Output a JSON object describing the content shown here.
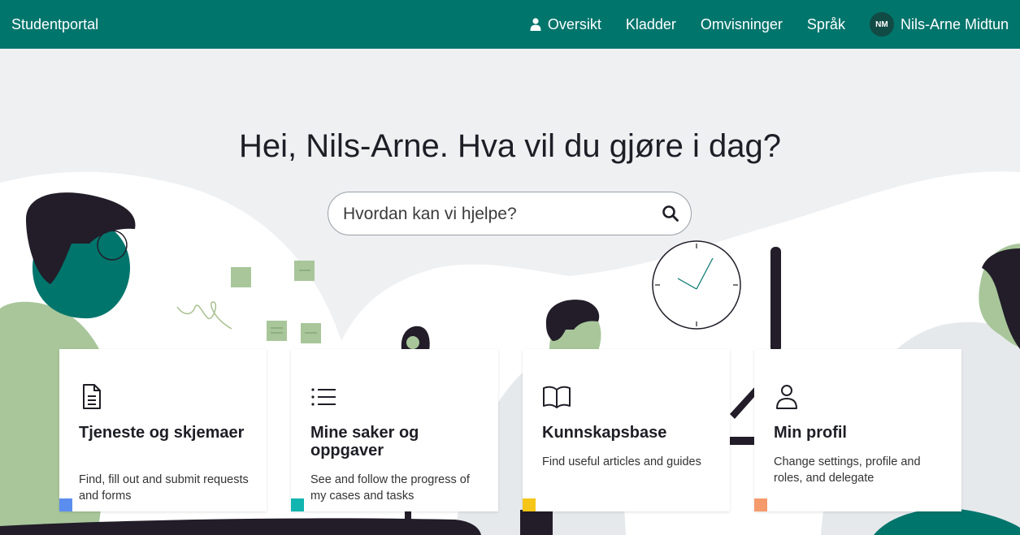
{
  "app": {
    "brand": "Studentportal"
  },
  "nav": {
    "items": [
      {
        "label": "Oversikt",
        "icon": "user-icon"
      },
      {
        "label": "Kladder"
      },
      {
        "label": "Omvisninger"
      },
      {
        "label": "Språk"
      }
    ],
    "user": {
      "initials": "NM",
      "name": "Nils-Arne Midtun"
    }
  },
  "hero": {
    "greeting": "Hei, Nils-Arne. Hva vil du gjøre i dag?"
  },
  "search": {
    "placeholder": "Hvordan kan vi hjelpe?",
    "value": "",
    "icon": "search-icon"
  },
  "cards": [
    {
      "title": "Tjeneste og skjemaer",
      "desc": "Find, fill out and submit requests and forms",
      "icon": "document-icon",
      "accent": "#5b8def"
    },
    {
      "title": "Mine saker og oppgaver",
      "desc": "See and follow the progress of my cases and tasks",
      "icon": "list-icon",
      "accent": "#12b5b0"
    },
    {
      "title": "Kunnskapsbase",
      "desc": "Find useful articles and guides",
      "icon": "book-icon",
      "accent": "#f5c518"
    },
    {
      "title": "Min profil",
      "desc": "Change settings, profile and roles, and delegate",
      "icon": "person-icon",
      "accent": "#f59a6b"
    }
  ],
  "colors": {
    "primary": "#00756c",
    "background": "#eef0f2",
    "text": "#1e1e26"
  }
}
